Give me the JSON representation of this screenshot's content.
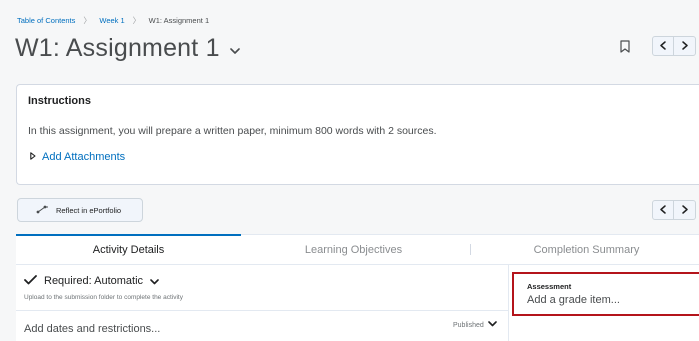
{
  "breadcrumb": {
    "items": [
      "Table of Contents",
      "Week 1",
      "W1: Assignment 1"
    ],
    "separator": "〉"
  },
  "page": {
    "title": "W1: Assignment 1"
  },
  "instructions": {
    "heading": "Instructions",
    "body": "In this assignment, you will prepare a written paper, minimum 800 words with 2 sources.",
    "attachments_label": "Add Attachments"
  },
  "toolbar": {
    "reflect_label": "Reflect in ePortfolio"
  },
  "tabs": [
    {
      "label": "Activity Details",
      "active": true
    },
    {
      "label": "Learning Objectives",
      "active": false
    },
    {
      "label": "Completion Summary",
      "active": false
    }
  ],
  "activity": {
    "requirement": "Required: Automatic",
    "requirement_hint": "Upload to the submission folder to complete the activity",
    "dates_label": "Add dates and restrictions...",
    "status": "Published"
  },
  "assessment": {
    "label": "Assessment",
    "grade_link": "Add a grade item..."
  },
  "colors": {
    "link": "#006fbf",
    "accent_tab": "#006fbf",
    "highlight": "#b4141b",
    "text": "#494c4e"
  }
}
